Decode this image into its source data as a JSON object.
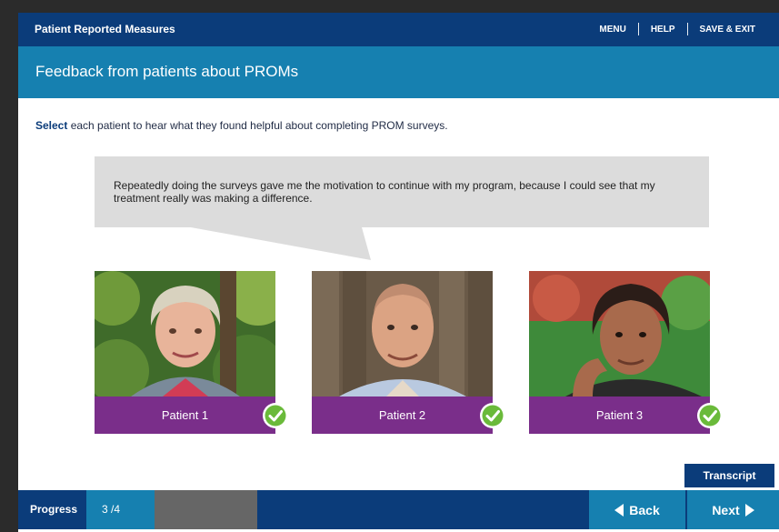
{
  "header": {
    "title": "Patient Reported Measures",
    "menu_label": "MENU",
    "help_label": "HELP",
    "save_exit_label": "SAVE & EXIT"
  },
  "page": {
    "title": "Feedback from patients about PROMs",
    "instruction_bold": "Select",
    "instruction_rest": " each patient to hear what they found helpful about completing PROM surveys."
  },
  "bubble": {
    "quote": "Repeatedly doing the surveys gave me the motivation to continue with my program, because I could see that my treatment really was making a difference."
  },
  "patients": [
    {
      "label": "Patient 1",
      "completed": true
    },
    {
      "label": "Patient 2",
      "completed": true
    },
    {
      "label": "Patient 3",
      "completed": true
    }
  ],
  "transcript_label": "Transcript",
  "footer": {
    "progress_label": "Progress",
    "progress_count": "3 /4",
    "progress_fraction": 0.75,
    "back_label": "Back",
    "next_label": "Next"
  },
  "colors": {
    "navy": "#0b3c7a",
    "teal": "#1680b0",
    "purple": "#7a2e8a",
    "check_green": "#6aba3a"
  },
  "icons": {
    "check": "check-circle-icon",
    "back": "triangle-left-icon",
    "next": "triangle-right-icon"
  }
}
